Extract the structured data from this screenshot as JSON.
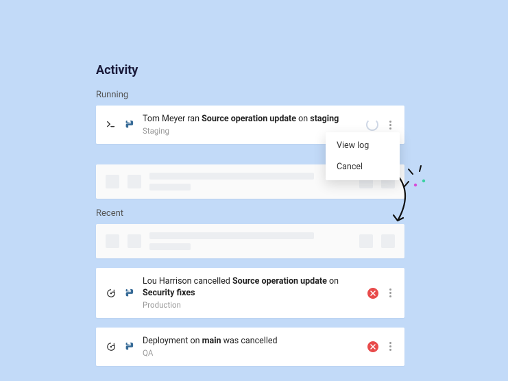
{
  "title": "Activity",
  "sections": {
    "running": "Running",
    "recent": "Recent"
  },
  "menu": {
    "view_log": "View log",
    "cancel": "Cancel"
  },
  "items": {
    "running1": {
      "prefix": "Tom Meyer ran ",
      "op": "Source operation update",
      "mid": " on ",
      "target": "staging",
      "env": "Staging"
    },
    "cancelled1": {
      "prefix": "Lou Harrison cancelled ",
      "op": "Source operation update",
      "mid": " on ",
      "target": "Security fixes",
      "env": "Production"
    },
    "cancelled2": {
      "prefix": "Deployment on ",
      "op": "main",
      "suffix": " was cancelled",
      "env": "QA"
    }
  },
  "icons": {
    "terminal": "terminal",
    "python": "python",
    "redeploy": "redeploy",
    "spinner": "loading",
    "cancel_badge": "error",
    "kebab": "more"
  }
}
